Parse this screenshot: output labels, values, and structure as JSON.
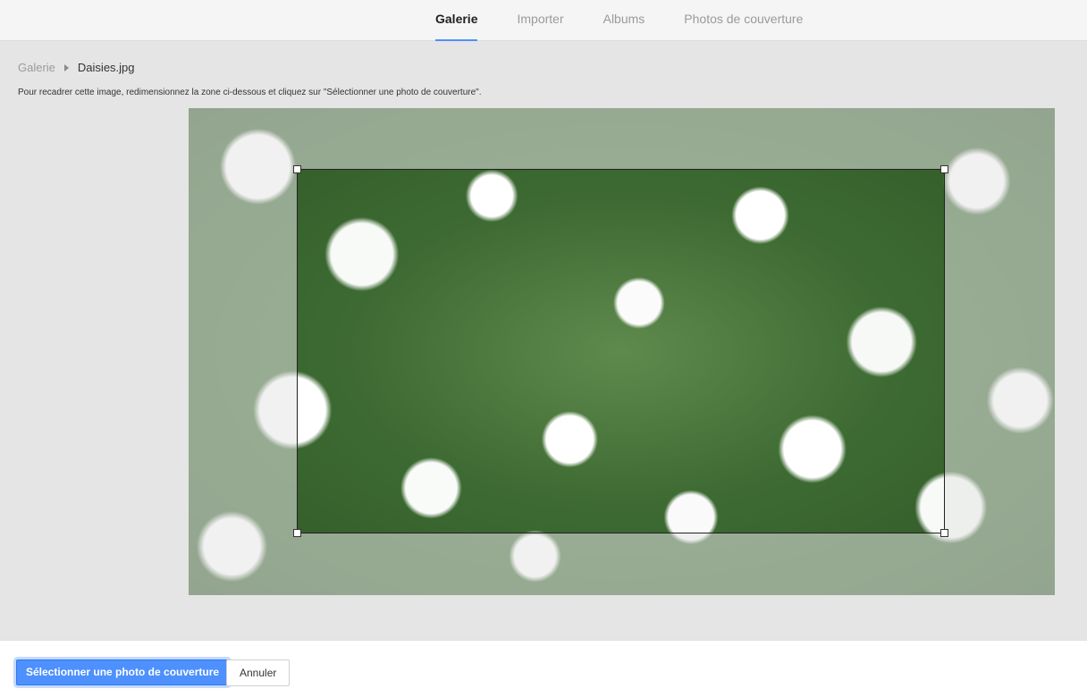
{
  "tabs": [
    {
      "label": "Galerie",
      "active": true
    },
    {
      "label": "Importer",
      "active": false
    },
    {
      "label": "Albums",
      "active": false
    },
    {
      "label": "Photos de couverture",
      "active": false
    }
  ],
  "breadcrumb": {
    "parent": "Galerie",
    "separator_icon": "triangle-right",
    "current": "Daisies.jpg"
  },
  "instructions": "Pour recadrer cette image, redimensionnez la zone ci-dessous et cliquez sur \"Sélectionner une photo de couverture\".",
  "actions": {
    "primary_label": "Sélectionner une photo de couverture",
    "secondary_label": "Annuler"
  },
  "colors": {
    "accent": "#4d90fe",
    "background": "#e5e5e5"
  }
}
